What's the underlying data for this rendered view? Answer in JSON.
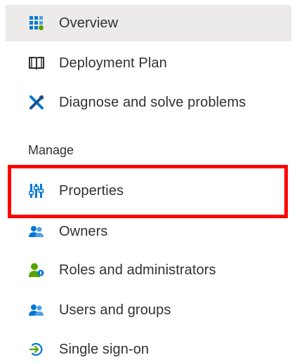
{
  "nav": {
    "items": [
      {
        "label": "Overview",
        "icon": "overview-grid-icon"
      },
      {
        "label": "Deployment Plan",
        "icon": "book-icon"
      },
      {
        "label": "Diagnose and solve problems",
        "icon": "tools-icon"
      }
    ],
    "manage_heading": "Manage",
    "manage_items": [
      {
        "label": "Properties",
        "icon": "properties-icon"
      },
      {
        "label": "Owners",
        "icon": "owners-icon"
      },
      {
        "label": "Roles and administrators",
        "icon": "roles-icon"
      },
      {
        "label": "Users and groups",
        "icon": "users-groups-icon"
      },
      {
        "label": "Single sign-on",
        "icon": "single-sign-on-icon"
      }
    ]
  },
  "colors": {
    "selected_bg": "#edebe9",
    "highlight": "#ff0000",
    "azure_blue": "#0078d4",
    "green": "#57a300"
  }
}
